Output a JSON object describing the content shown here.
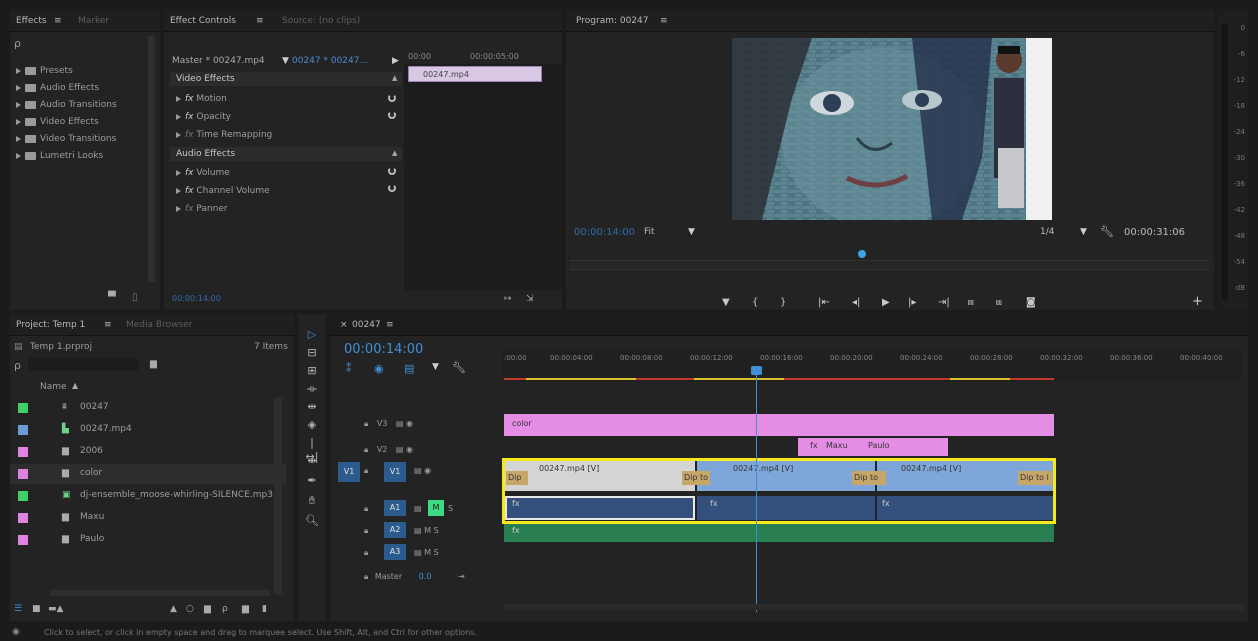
{
  "effects_panel": {
    "tabs": [
      "Effects",
      "Marker"
    ],
    "search_glyph": "ρ",
    "items": [
      "Presets",
      "Audio Effects",
      "Audio Transitions",
      "Video Effects",
      "Video Transitions",
      "Lumetri Looks"
    ]
  },
  "effect_controls": {
    "tabs": [
      "Effect Controls",
      "Source: (no clips)"
    ],
    "master_clip": "Master * 00247.mp4",
    "sequence_clip": "00247 * 00247...",
    "time_start": "00:00",
    "time_end": "00:00:05:00",
    "clip_label": "00247.mp4",
    "video_header": "Video Effects",
    "video_effects": [
      "Motion",
      "Opacity",
      "Time Remapping"
    ],
    "audio_header": "Audio Effects",
    "audio_effects": [
      "Volume",
      "Channel Volume",
      "Panner"
    ],
    "timecode": "00:00:14:00"
  },
  "program": {
    "tab": "Program: 00247",
    "timecode": "00:00:14:00",
    "fit": "Fit",
    "resolution": "1/4",
    "duration": "00:00:31:06"
  },
  "meters": {
    "ticks": [
      "0",
      "-6",
      "-12",
      "-18",
      "-24",
      "-30",
      "-36",
      "-42",
      "-48",
      "-54",
      "dB"
    ]
  },
  "project": {
    "tabs": [
      "Project: Temp 1",
      "Media Browser"
    ],
    "file": "Temp 1.prproj",
    "count": "7 Items",
    "name_header": "Name",
    "items": [
      {
        "name": "00247",
        "color": "#3fcf6a"
      },
      {
        "name": "00247.mp4",
        "color": "#6c9bd6"
      },
      {
        "name": "2006",
        "color": "#e082e0"
      },
      {
        "name": "color",
        "color": "#e082e0"
      },
      {
        "name": "dj-ensemble_moose-whirling-SILENCE.mp3",
        "color": "#3fcf6a"
      },
      {
        "name": "Maxu",
        "color": "#e082e0"
      },
      {
        "name": "Paulo",
        "color": "#e082e0"
      }
    ]
  },
  "timeline": {
    "tab": "00247",
    "timecode": "00:00:14:00",
    "ruler": [
      ":00:00",
      "00:00:04:00",
      "00:00:08:00",
      "00:00:12:00",
      "00:00:16:00",
      "00:00:20:00",
      "00:00:24:00",
      "00:00:28:00",
      "00:00:32:00",
      "00:00:36:00",
      "00:00:40:00"
    ],
    "tracks": {
      "v3": "V3",
      "v2": "V2",
      "v1": "V1",
      "a1": "A1",
      "a2": "A2",
      "a3": "A3",
      "master": "Master",
      "master_val": "0.0"
    },
    "clips": {
      "color": "color",
      "maxu": "Maxu",
      "paulo": "Paulo",
      "clip1": "00247.mp4 [V]",
      "clip2": "00247.mp4 [V]",
      "clip3": "00247.mp4 [V]",
      "dip1": "Dip",
      "dip2": "Dip to",
      "dip3": "Dip to",
      "dip4": "Dip to l"
    }
  },
  "status": {
    "text": "Click to select, or click in empty space and drag to marquee select. Use Shift, Alt, and Ctrl for other options."
  }
}
